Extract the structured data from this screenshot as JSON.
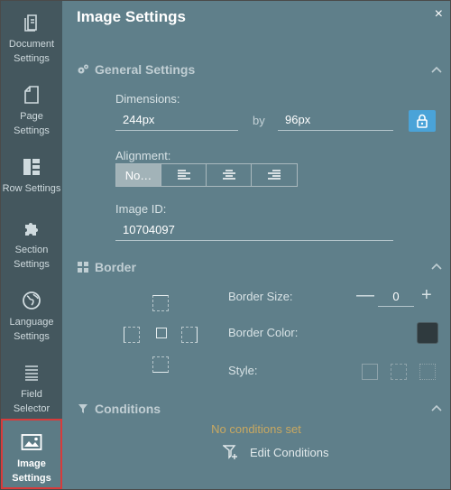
{
  "rail": {
    "items": [
      {
        "label_l1": "Document",
        "label_l2": "Settings",
        "icon": "document-icon"
      },
      {
        "label_l1": "Page",
        "label_l2": "Settings",
        "icon": "page-icon"
      },
      {
        "label_l1": "Row Settings",
        "label_l2": "",
        "icon": "row-layout-icon"
      },
      {
        "label_l1": "Section",
        "label_l2": "Settings",
        "icon": "puzzle-icon"
      },
      {
        "label_l1": "Language",
        "label_l2": "Settings",
        "icon": "globe-icon"
      },
      {
        "label_l1": "Field",
        "label_l2": "Selector",
        "icon": "list-icon"
      },
      {
        "label_l1": "Image",
        "label_l2": "Settings",
        "icon": "image-icon",
        "active": true
      }
    ]
  },
  "header": {
    "title": "Image Settings",
    "close": "×"
  },
  "general": {
    "heading": "General Settings",
    "dimensions_label": "Dimensions:",
    "width_value": "244px",
    "by_label": "by",
    "height_value": "96px",
    "alignment_label": "Alignment:",
    "alignment_options": [
      "No…"
    ],
    "image_id_label": "Image ID:",
    "image_id_value": "10704097"
  },
  "border": {
    "heading": "Border",
    "size_label": "Border Size:",
    "size_value": "0",
    "minus": "—",
    "plus": "+",
    "color_label": "Border Color:",
    "color_value": "#2f3a3e",
    "style_label": "Style:"
  },
  "conditions": {
    "heading": "Conditions",
    "empty_text": "No conditions set",
    "edit_label": "Edit Conditions"
  },
  "colors": {
    "rail_bg": "#44575e",
    "panel_bg": "#5f7f8a",
    "accent": "#4aa3d8",
    "active_outline": "#d83b3b",
    "conditions_text": "#c9a860"
  }
}
